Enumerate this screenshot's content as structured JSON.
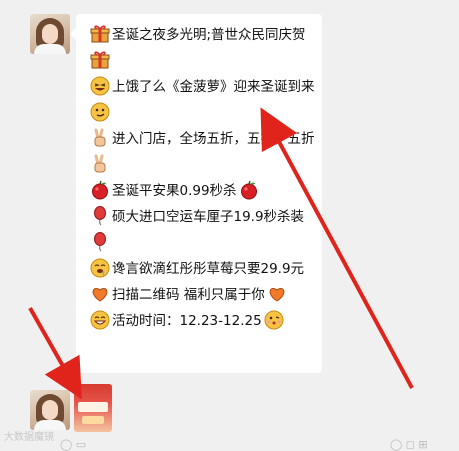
{
  "messages": [
    {
      "lines": [
        {
          "pre_icon": "gift-icon",
          "text": "圣诞之夜多光明;普世众民同庆贺",
          "post_icon": null
        },
        {
          "pre_icon": "gift-icon",
          "text": "",
          "post_icon": null
        },
        {
          "pre_icon": "grin-squint-icon",
          "text": "上饿了么《金菠萝》迎来圣诞到来",
          "post_icon": "smirk-icon"
        },
        {
          "pre_icon": "victory-hand-icon",
          "text": "进入门店，全场五折，五折，五折",
          "post_icon": "victory-hand-icon"
        },
        {
          "pre_icon": "apple-icon",
          "text": "圣诞平安果0.99秒杀",
          "post_icon": "apple-icon"
        },
        {
          "pre_icon": "balloon-icon",
          "text": "硕大进口空运车厘子19.9秒杀装",
          "post_icon": "balloon-icon"
        },
        {
          "pre_icon": "drool-icon",
          "text": "谗言欲滴红彤彤草莓只要29.9元",
          "post_icon": null
        },
        {
          "pre_icon": "heart-icon",
          "text": "扫描二维码 福利只属于你",
          "post_icon": "heart-icon"
        },
        {
          "pre_icon": "grin-icon",
          "text": "活动时间：12.23-12.25",
          "post_icon": "kiss-icon"
        }
      ]
    }
  ],
  "watermark": "大数据魔镜",
  "colors": {
    "background": "#f0f0f0",
    "bubble": "#ffffff",
    "annotation_arrow": "#e0241b"
  }
}
